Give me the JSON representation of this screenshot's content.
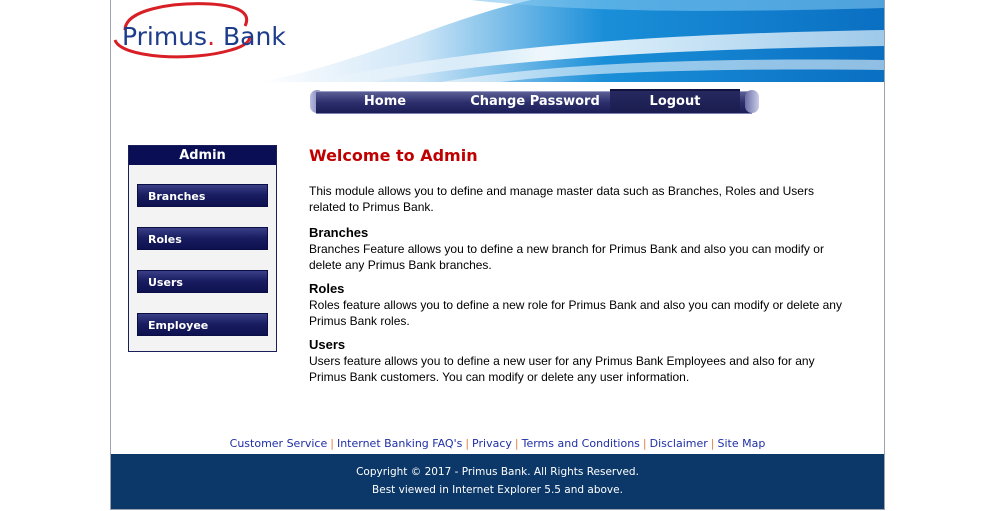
{
  "brand": {
    "logo_text_left": "Primus",
    "logo_dot": ".",
    "logo_text_right": "Bank",
    "colors": {
      "logo_blue": "#1d3d8b",
      "logo_red": "#d81f26",
      "nav_dark": "#1b1e56",
      "footer_bg": "#0b3868"
    }
  },
  "nav": {
    "home": "Home",
    "change_password": "Change Password",
    "logout": "Logout"
  },
  "sidebar": {
    "title": "Admin",
    "items": [
      {
        "label": "Branches"
      },
      {
        "label": "Roles"
      },
      {
        "label": "Users"
      },
      {
        "label": "Employee"
      }
    ]
  },
  "main": {
    "heading": "Welcome to Admin",
    "intro": "This module allows you to define and manage master data such as Branches, Roles and Users related to Primus Bank.",
    "sections": [
      {
        "title": "Branches",
        "body": "Branches Feature allows you to define a new branch for Primus Bank and also you can modify or delete any Primus Bank branches."
      },
      {
        "title": "Roles",
        "body": "Roles feature allows you to define a new role for Primus Bank and also you can modify or delete any Primus Bank roles."
      },
      {
        "title": "Users",
        "body": "Users feature allows you to define a new user for any Primus Bank Employees and also for any Primus Bank customers. You can modify or delete any user information."
      }
    ]
  },
  "footer": {
    "links": [
      "Customer Service",
      "Internet Banking FAQ's",
      "Privacy",
      "Terms and Conditions",
      "Disclaimer",
      "Site Map"
    ],
    "separator": "|",
    "copyright": "Copyright © 2017 - Primus Bank. All Rights Reserved.",
    "browser_note": "Best viewed in Internet Explorer 5.5 and above."
  }
}
